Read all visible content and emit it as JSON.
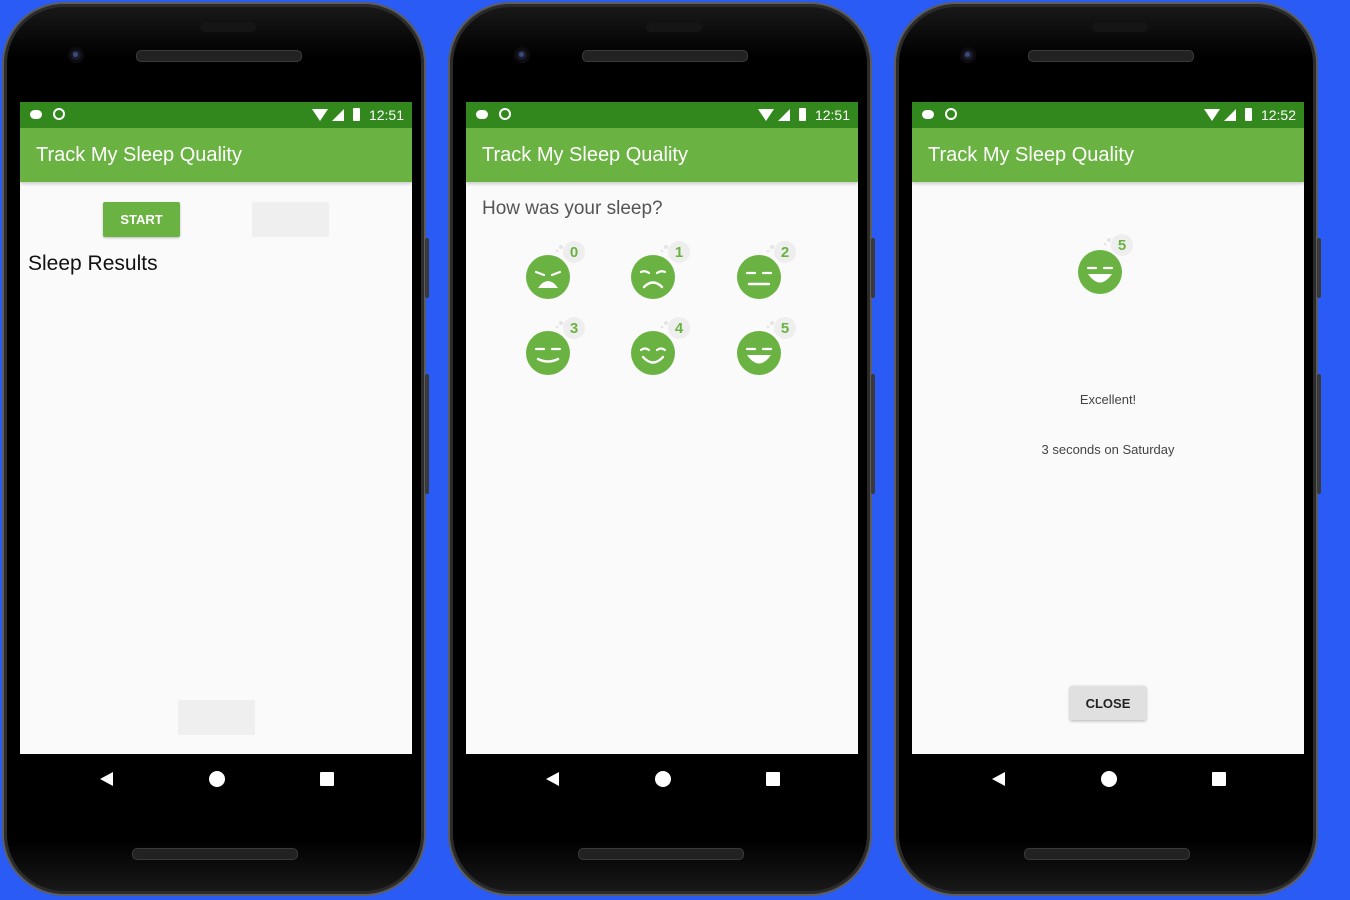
{
  "colors": {
    "background": "#2a5cf5",
    "status_bar": "#33881d",
    "app_bar": "#6ab343",
    "face_green": "#6ab343",
    "screen_bg": "#fafafa"
  },
  "app": {
    "title": "Track My Sleep Quality"
  },
  "screens": [
    {
      "status_time": "12:51",
      "start_button": "START",
      "results_title": "Sleep Results"
    },
    {
      "status_time": "12:51",
      "question": "How was your sleep?",
      "faces": [
        {
          "label": "0",
          "icon": "sleep-quality-0-icon"
        },
        {
          "label": "1",
          "icon": "sleep-quality-1-icon"
        },
        {
          "label": "2",
          "icon": "sleep-quality-2-icon"
        },
        {
          "label": "3",
          "icon": "sleep-quality-3-icon"
        },
        {
          "label": "4",
          "icon": "sleep-quality-4-icon"
        },
        {
          "label": "5",
          "icon": "sleep-quality-5-icon"
        }
      ]
    },
    {
      "status_time": "12:52",
      "face_label": "5",
      "quality": "Excellent!",
      "duration": "3 seconds on Saturday",
      "close_button": "CLOSE"
    }
  ],
  "icons": {
    "status_left": [
      "notification-cloud-icon",
      "notification-circle-icon"
    ],
    "status_right": [
      "wifi-icon",
      "signal-icon",
      "battery-icon"
    ],
    "nav": [
      "back-icon",
      "home-icon",
      "recents-icon"
    ]
  }
}
